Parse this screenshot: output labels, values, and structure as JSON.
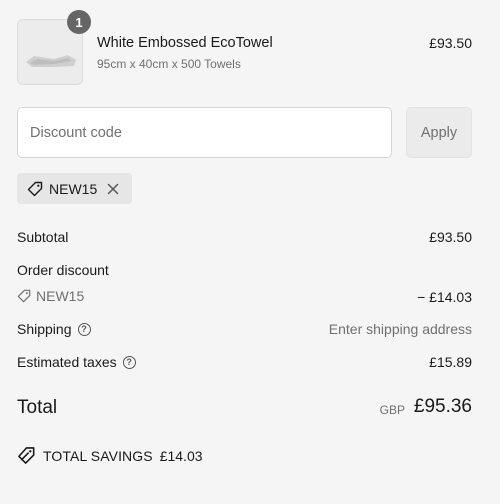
{
  "product": {
    "quantity": "1",
    "name": "White Embossed EcoTowel",
    "variant": "95cm x 40cm x 500 Towels",
    "price": "£93.50",
    "image_icon": "towel-image"
  },
  "discount": {
    "placeholder": "Discount code",
    "value": "",
    "apply_label": "Apply",
    "applied_code": "NEW15"
  },
  "summary": {
    "subtotal_label": "Subtotal",
    "subtotal_value": "£93.50",
    "order_discount_label": "Order discount",
    "discount_code": "NEW15",
    "discount_value": "− £14.03",
    "shipping_label": "Shipping",
    "shipping_value": "Enter shipping address",
    "taxes_label": "Estimated taxes",
    "taxes_value": "£15.89",
    "total_label": "Total",
    "total_currency": "GBP",
    "total_value": "£95.36",
    "savings_label": "TOTAL SAVINGS",
    "savings_value": "£14.03"
  },
  "colors": {
    "background": "#f5f5f5",
    "text": "#1a1a1a",
    "muted": "#707070",
    "badge": "#666666"
  }
}
